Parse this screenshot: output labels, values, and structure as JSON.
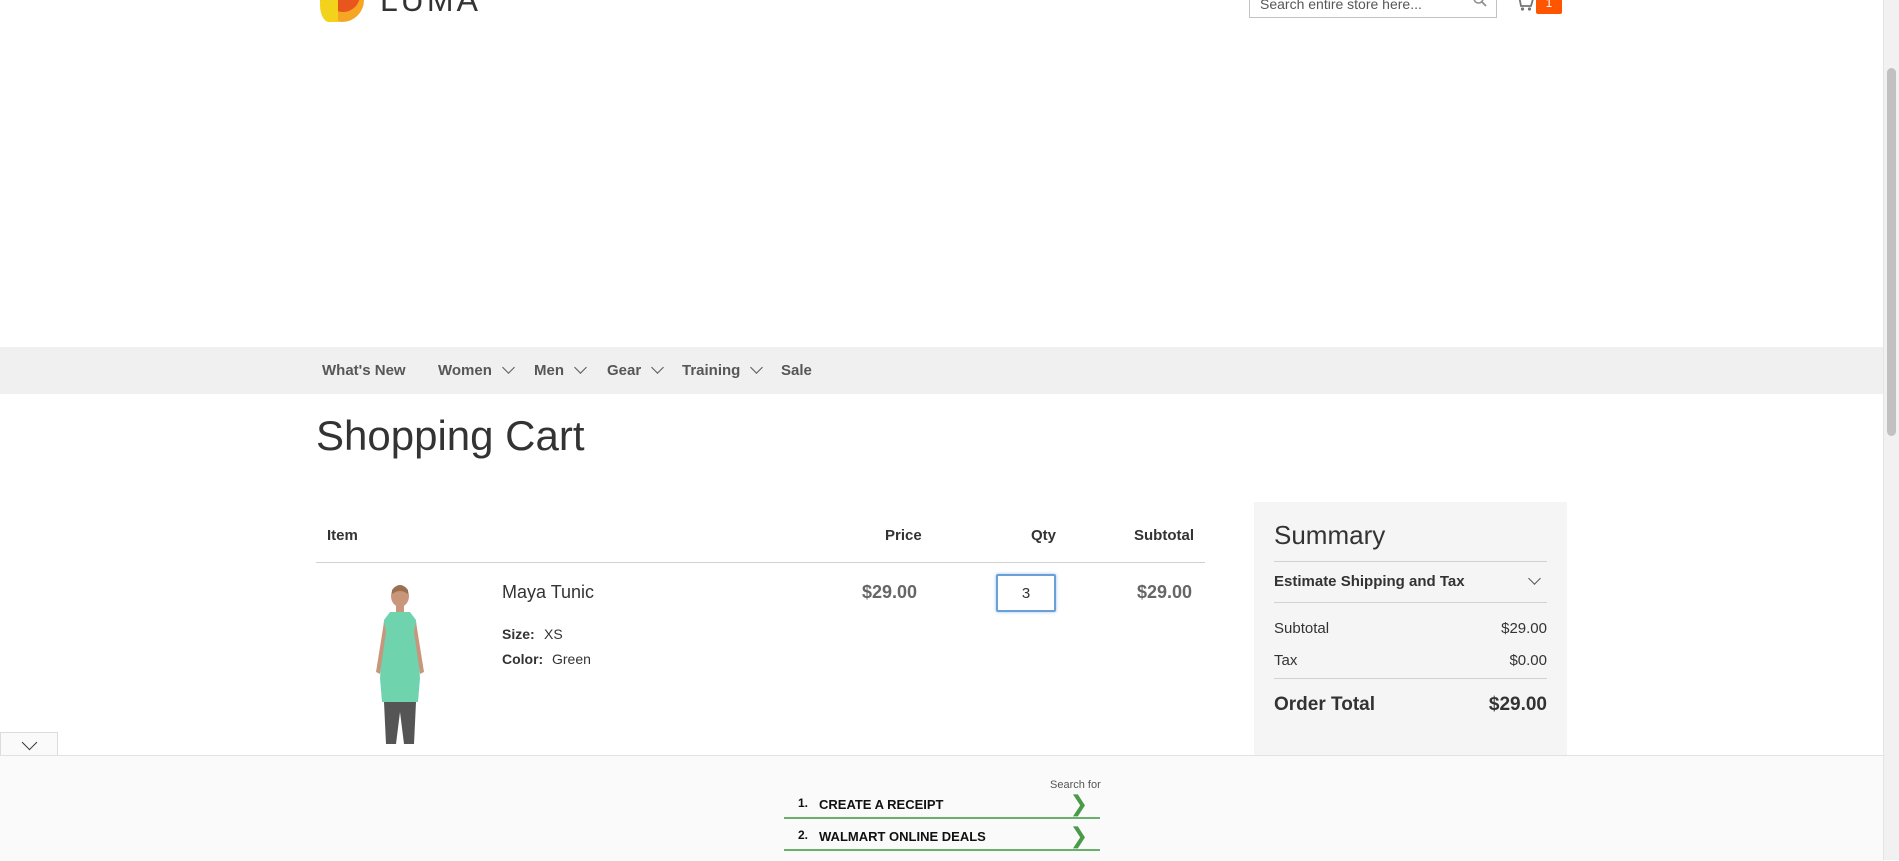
{
  "header": {
    "logo_text": "LUMA",
    "search_placeholder": "Search entire store here...",
    "cart_count": "1"
  },
  "nav": {
    "items": [
      {
        "label": "What's New",
        "has_dropdown": false
      },
      {
        "label": "Women",
        "has_dropdown": true
      },
      {
        "label": "Men",
        "has_dropdown": true
      },
      {
        "label": "Gear",
        "has_dropdown": true
      },
      {
        "label": "Training",
        "has_dropdown": true
      },
      {
        "label": "Sale",
        "has_dropdown": false
      }
    ]
  },
  "page": {
    "title": "Shopping Cart"
  },
  "cart": {
    "columns": {
      "item": "Item",
      "price": "Price",
      "qty": "Qty",
      "subtotal": "Subtotal"
    },
    "items": [
      {
        "name": "Maya Tunic",
        "options": [
          {
            "label": "Size:",
            "value": "XS"
          },
          {
            "label": "Color:",
            "value": "Green"
          }
        ],
        "price": "$29.00",
        "qty": "3",
        "subtotal": "$29.00"
      }
    ]
  },
  "summary": {
    "title": "Summary",
    "estimate_label": "Estimate Shipping and Tax",
    "subtotal_label": "Subtotal",
    "subtotal_value": "$29.00",
    "tax_label": "Tax",
    "tax_value": "$0.00",
    "order_total_label": "Order Total",
    "order_total_value": "$29.00"
  },
  "ad": {
    "search_for": "Search for",
    "results": [
      {
        "num": "1.",
        "text": "CREATE A RECEIPT"
      },
      {
        "num": "2.",
        "text": "WALMART ONLINE DEALS"
      }
    ]
  },
  "colors": {
    "accent": "#ff5501",
    "nav_bg": "#f0f0f0",
    "summary_bg": "#f5f5f5",
    "ad_border": "#6ab06a"
  }
}
